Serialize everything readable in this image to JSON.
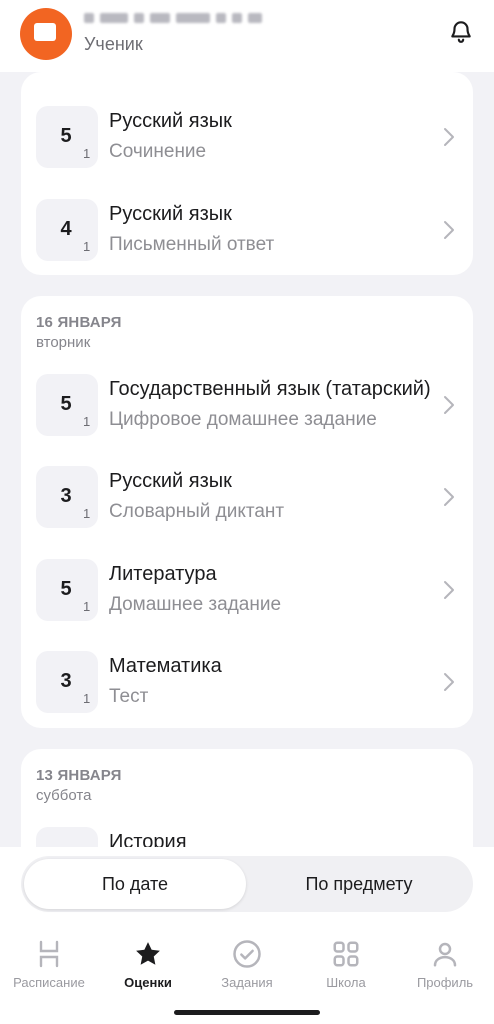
{
  "header": {
    "role": "Ученик"
  },
  "cards": [
    {
      "rows": [
        {
          "grade": "5",
          "weight": "1",
          "subject": "Русский язык",
          "work_type": "Сочинение"
        },
        {
          "grade": "4",
          "weight": "1",
          "subject": "Русский язык",
          "work_type": "Письменный ответ"
        }
      ]
    },
    {
      "date": "16 ЯНВАРЯ",
      "weekday": "вторник",
      "rows": [
        {
          "grade": "5",
          "weight": "1",
          "subject": "Государственный язык (татарский)",
          "work_type": "Цифровое домашнее задание"
        },
        {
          "grade": "3",
          "weight": "1",
          "subject": "Русский язык",
          "work_type": "Словарный диктант"
        },
        {
          "grade": "5",
          "weight": "1",
          "subject": "Литература",
          "work_type": "Домашнее задание"
        },
        {
          "grade": "3",
          "weight": "1",
          "subject": "Математика",
          "work_type": "Тест"
        }
      ]
    },
    {
      "date": "13 ЯНВАРЯ",
      "weekday": "суббота",
      "rows": [
        {
          "subject": "История"
        }
      ]
    }
  ],
  "segment": {
    "by_date": "По дате",
    "by_subject": "По предмету",
    "selected": "По дате"
  },
  "tabbar": {
    "items": [
      {
        "label": "Расписание",
        "icon": "schedule-icon"
      },
      {
        "label": "Оценки",
        "icon": "star-icon",
        "active": true
      },
      {
        "label": "Задания",
        "icon": "check-circle-icon"
      },
      {
        "label": "Школа",
        "icon": "grid-icon"
      },
      {
        "label": "Профиль",
        "icon": "person-icon"
      }
    ]
  },
  "colors": {
    "accent": "#f26522",
    "background": "#f2f2f6"
  }
}
